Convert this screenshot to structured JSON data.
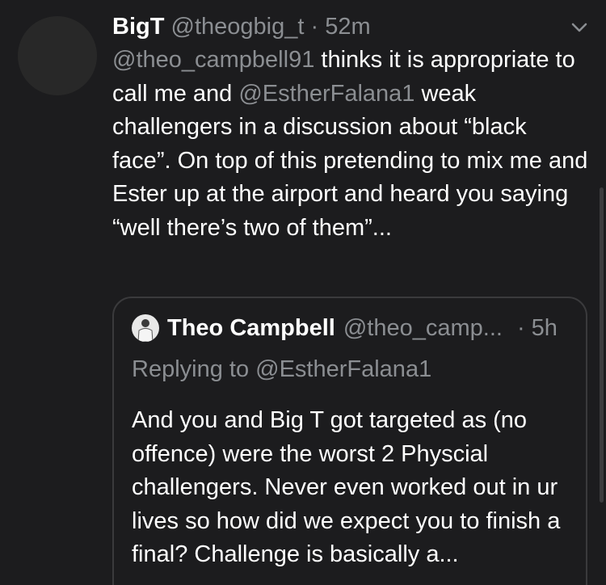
{
  "tweet": {
    "display_name": "BigT",
    "handle": "@theogbig_t",
    "separator": "·",
    "time": "52m",
    "mention_1": "@theo_campbell91",
    "text_1": " thinks it is appropriate to call me and ",
    "mention_2": "@EstherFalana1",
    "text_2": " weak challengers in a discussion about “black face”. On top of this pretending to mix me and Ester up at the airport and heard you saying “well there’s two of them”..."
  },
  "quoted_tweet": {
    "display_name": "Theo Campbell",
    "handle": "@theo_camp...",
    "time": "· 5h",
    "replying_to": "Replying to @EstherFalana1",
    "text": "And you and Big T got targeted as (no offence) were the worst 2 Physcial challengers. Never even worked out in ur lives so how did we expect you to finish a final? Challenge is basically a..."
  },
  "icons": {
    "menu": "chevron-down-icon",
    "quoted_avatar": "avatar"
  },
  "colors": {
    "background": "#1c1c1e",
    "secondary_text": "#8b8e92",
    "border": "#3a3a3c"
  }
}
